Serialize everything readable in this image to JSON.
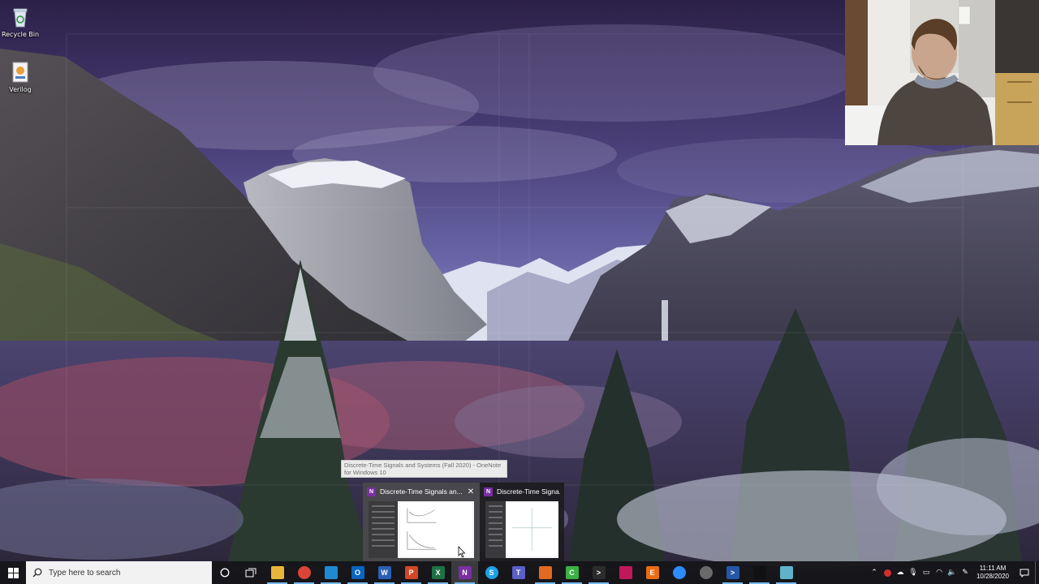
{
  "desktop": {
    "icons": [
      {
        "label": "Recycle Bin",
        "icon": "recycle-bin-icon"
      },
      {
        "label": "Verilog",
        "icon": "verilog-icon"
      }
    ]
  },
  "tooltip": {
    "text": "Discrete-Time Signals and Systems (Fall 2020) - OneNote for Windows 10"
  },
  "thumbnails": [
    {
      "title": "Discrete-Time Signals an...",
      "close": "✕",
      "app_letter": "N"
    },
    {
      "title": "Discrete-Time Signa...",
      "app_letter": "N"
    }
  ],
  "taskbar": {
    "search_placeholder": "Type here to search",
    "apps": [
      {
        "name": "file-explorer",
        "letter": "",
        "color": "#e8b63a"
      },
      {
        "name": "chrome",
        "letter": "",
        "color": "#db4437"
      },
      {
        "name": "vs-code",
        "letter": "",
        "color": "#1f8ad2"
      },
      {
        "name": "outlook",
        "letter": "O",
        "color": "#0a64c2"
      },
      {
        "name": "word",
        "letter": "W",
        "color": "#2b5fb5"
      },
      {
        "name": "powerpoint",
        "letter": "P",
        "color": "#d24726"
      },
      {
        "name": "excel",
        "letter": "X",
        "color": "#1e7145"
      },
      {
        "name": "onenote",
        "letter": "N",
        "color": "#7b2fa3"
      },
      {
        "name": "skype",
        "letter": "S",
        "color": "#1ea0e6"
      },
      {
        "name": "teams",
        "letter": "T",
        "color": "#5b5fc7"
      },
      {
        "name": "matlab",
        "letter": "",
        "color": "#e16a1f"
      },
      {
        "name": "camtasia",
        "letter": "C",
        "color": "#3bb143"
      },
      {
        "name": "terminal",
        "letter": ">",
        "color": "#2c2c2c"
      },
      {
        "name": "snip-tool",
        "letter": "",
        "color": "#c2185b"
      },
      {
        "name": "epic-games",
        "letter": "E",
        "color": "#e86c13"
      },
      {
        "name": "zoom",
        "letter": "",
        "color": "#2d8cff"
      },
      {
        "name": "network-tool",
        "letter": "",
        "color": "#6a6a6a"
      },
      {
        "name": "powershell",
        "letter": ">",
        "color": "#2657a6"
      },
      {
        "name": "command-prompt",
        "letter": "",
        "color": "#111111"
      },
      {
        "name": "notepad",
        "letter": "",
        "color": "#5fb3c9"
      }
    ],
    "clock_time": "11:11 AM",
    "clock_date": "10/28/2020"
  }
}
